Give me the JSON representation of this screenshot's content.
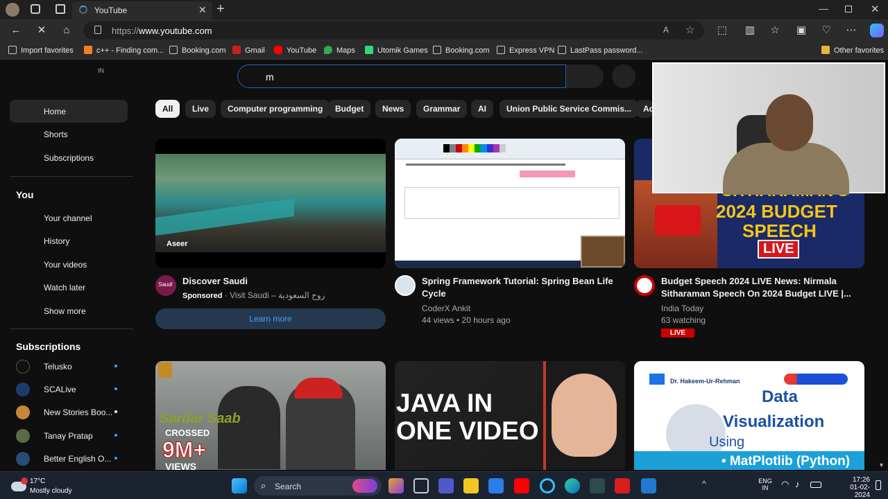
{
  "browser": {
    "tab_title": "YouTube",
    "url_prefix": "https://",
    "url_host": "www.youtube.com",
    "bookmarks": [
      "Import favorites",
      "c++ - Finding com...",
      "Booking.com",
      "Gmail",
      "YouTube",
      "Maps",
      "Utomik Games",
      "Booking.com",
      "Express VPN",
      "LastPass password...",
      "Other favorites"
    ]
  },
  "youtube": {
    "country_code": "IN",
    "search_value": "m",
    "sidebar": {
      "main": [
        "Home",
        "Shorts",
        "Subscriptions"
      ],
      "you_header": "You",
      "you_items": [
        "Your channel",
        "History",
        "Your videos",
        "Watch later",
        "Show more"
      ],
      "subs_header": "Subscriptions",
      "subs": [
        "Telusko",
        "SCALive",
        "New Stories Boo...",
        "Tanay Pratap",
        "Better English O..."
      ]
    },
    "chips": [
      "All",
      "Live",
      "Computer programming",
      "Budget",
      "News",
      "Grammar",
      "AI",
      "Union Public Service Commis...",
      "Ac"
    ],
    "videos": [
      {
        "title": "Discover Saudi",
        "sponsored": "Sponsored",
        "channel": "· Visit Saudi – روح السعودية",
        "cta": "Learn more",
        "thumb_text": "Aseer",
        "avatar_text": "Saudi"
      },
      {
        "title_line1": "Spring Framework Tutorial: Spring Bean Life",
        "title_line2": "Cycle",
        "channel": "CoderX Ankit",
        "meta": "44 views • 20 hours ago"
      },
      {
        "title_line1": "Budget Speech 2024 LIVE News: Nirmala",
        "title_line2": "Sitharaman Speech On 2024 Budget LIVE |...",
        "channel": "India Today",
        "meta": "63 watching",
        "badge": "LIVE",
        "thumb_line1": "SITHARAMAN'S",
        "thumb_line2": "2024 BUDGET",
        "thumb_line3": "SPEECH",
        "thumb_badge": "LIVE"
      }
    ],
    "row2": [
      {
        "thumb_line1": "Sardar Saab",
        "thumb_line2": "CROSSED",
        "thumb_line3": "9M+",
        "thumb_line4": "VIEWS"
      },
      {
        "thumb_line1": "JAVA IN",
        "thumb_line2": "ONE VIDEO"
      },
      {
        "author": "Dr. Hakeem-Ur-Rehman",
        "thumb_line1": "Data",
        "thumb_line2": "Visualization",
        "thumb_line3": "Using",
        "thumb_line4": "• MatPlotlib (Python)"
      }
    ]
  },
  "taskbar": {
    "weather_temp": "17°C",
    "weather_desc": "Mostly cloudy",
    "search_label": "Search",
    "lang1": "ENG",
    "lang2": "IN",
    "time": "17:26",
    "date": "01-02-2024"
  }
}
